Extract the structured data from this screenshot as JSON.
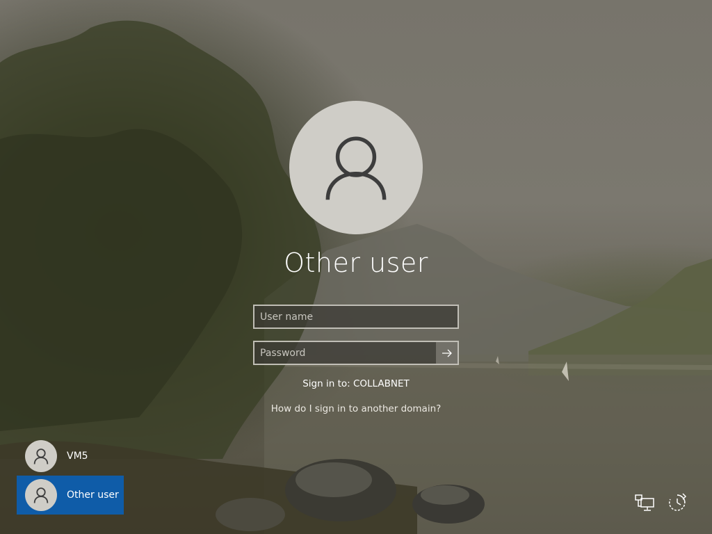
{
  "login": {
    "title": "Other user",
    "avatar_icon": "user-silhouette-icon",
    "username": {
      "value": "",
      "placeholder": "User name"
    },
    "password": {
      "value": "",
      "placeholder": "Password"
    },
    "submit_icon": "arrow-right-icon",
    "sign_in_to": "Sign in to: COLLABNET",
    "other_domain_link": "How do I sign in to another domain?"
  },
  "user_list": [
    {
      "label": "VM5",
      "icon": "user-silhouette-icon",
      "selected": false
    },
    {
      "label": "Other user",
      "icon": "user-silhouette-icon",
      "selected": true
    }
  ],
  "corner_icons": {
    "network": "network-icon",
    "ease_of_access": "ease-of-access-icon"
  },
  "colors": {
    "selected_tile": "#0f5ca8",
    "avatar_bg": "#cfcdc7"
  }
}
